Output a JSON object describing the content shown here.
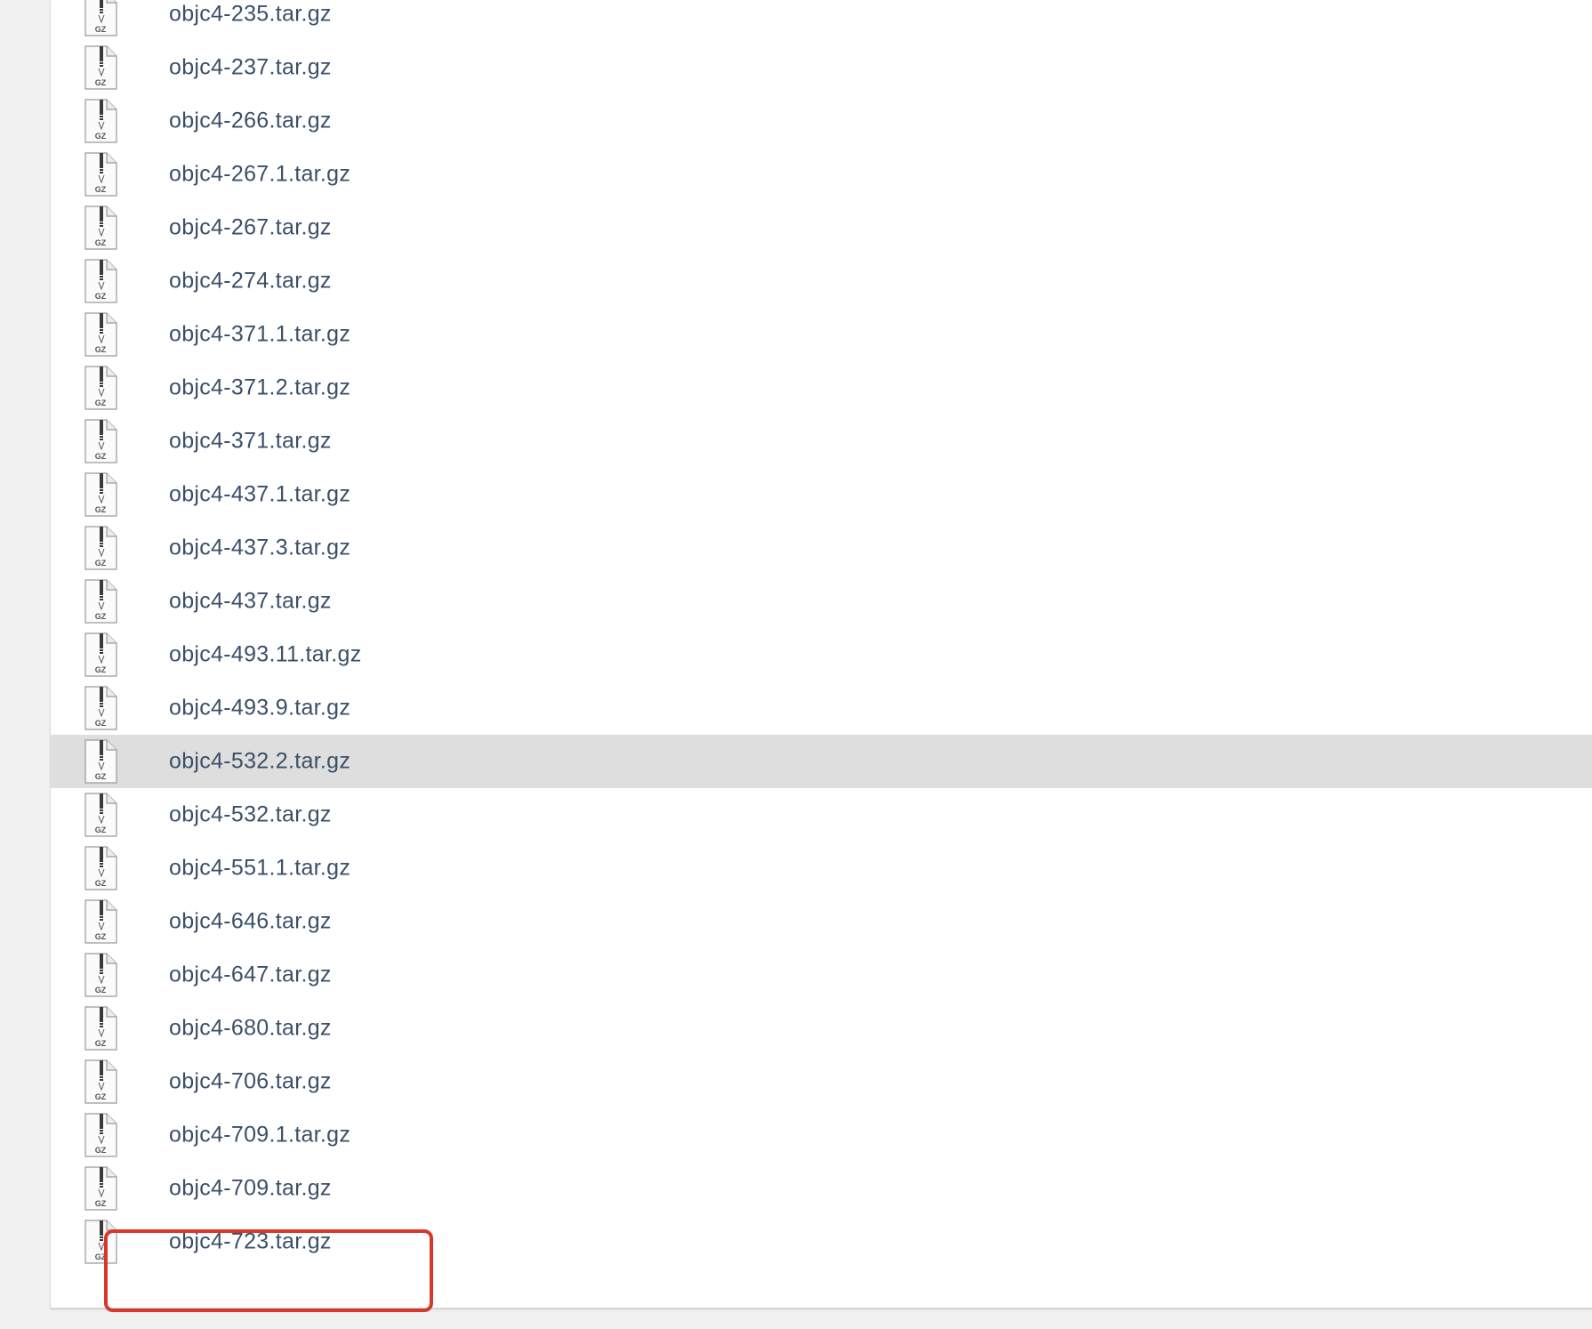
{
  "files": [
    {
      "name": "objc4-235.tar.gz",
      "icon": "gz-archive-icon",
      "icon_label": "GZ"
    },
    {
      "name": "objc4-237.tar.gz",
      "icon": "gz-archive-icon",
      "icon_label": "GZ"
    },
    {
      "name": "objc4-266.tar.gz",
      "icon": "gz-archive-icon",
      "icon_label": "GZ"
    },
    {
      "name": "objc4-267.1.tar.gz",
      "icon": "gz-archive-icon",
      "icon_label": "GZ"
    },
    {
      "name": "objc4-267.tar.gz",
      "icon": "gz-archive-icon",
      "icon_label": "GZ"
    },
    {
      "name": "objc4-274.tar.gz",
      "icon": "gz-archive-icon",
      "icon_label": "GZ"
    },
    {
      "name": "objc4-371.1.tar.gz",
      "icon": "gz-archive-icon",
      "icon_label": "GZ"
    },
    {
      "name": "objc4-371.2.tar.gz",
      "icon": "gz-archive-icon",
      "icon_label": "GZ"
    },
    {
      "name": "objc4-371.tar.gz",
      "icon": "gz-archive-icon",
      "icon_label": "GZ"
    },
    {
      "name": "objc4-437.1.tar.gz",
      "icon": "gz-archive-icon",
      "icon_label": "GZ"
    },
    {
      "name": "objc4-437.3.tar.gz",
      "icon": "gz-archive-icon",
      "icon_label": "GZ"
    },
    {
      "name": "objc4-437.tar.gz",
      "icon": "gz-archive-icon",
      "icon_label": "GZ"
    },
    {
      "name": "objc4-493.11.tar.gz",
      "icon": "gz-archive-icon",
      "icon_label": "GZ"
    },
    {
      "name": "objc4-493.9.tar.gz",
      "icon": "gz-archive-icon",
      "icon_label": "GZ"
    },
    {
      "name": "objc4-532.2.tar.gz",
      "icon": "gz-archive-icon",
      "icon_label": "GZ",
      "selected": true
    },
    {
      "name": "objc4-532.tar.gz",
      "icon": "gz-archive-icon",
      "icon_label": "GZ"
    },
    {
      "name": "objc4-551.1.tar.gz",
      "icon": "gz-archive-icon",
      "icon_label": "GZ"
    },
    {
      "name": "objc4-646.tar.gz",
      "icon": "gz-archive-icon",
      "icon_label": "GZ"
    },
    {
      "name": "objc4-647.tar.gz",
      "icon": "gz-archive-icon",
      "icon_label": "GZ"
    },
    {
      "name": "objc4-680.tar.gz",
      "icon": "gz-archive-icon",
      "icon_label": "GZ"
    },
    {
      "name": "objc4-706.tar.gz",
      "icon": "gz-archive-icon",
      "icon_label": "GZ"
    },
    {
      "name": "objc4-709.1.tar.gz",
      "icon": "gz-archive-icon",
      "icon_label": "GZ"
    },
    {
      "name": "objc4-709.tar.gz",
      "icon": "gz-archive-icon",
      "icon_label": "GZ"
    },
    {
      "name": "objc4-723.tar.gz",
      "icon": "gz-archive-icon",
      "icon_label": "GZ",
      "highlighted": true
    }
  ],
  "colors": {
    "link_text": "#3b4f68",
    "selected_row": "#dedede",
    "highlight_box": "#d9372b"
  }
}
